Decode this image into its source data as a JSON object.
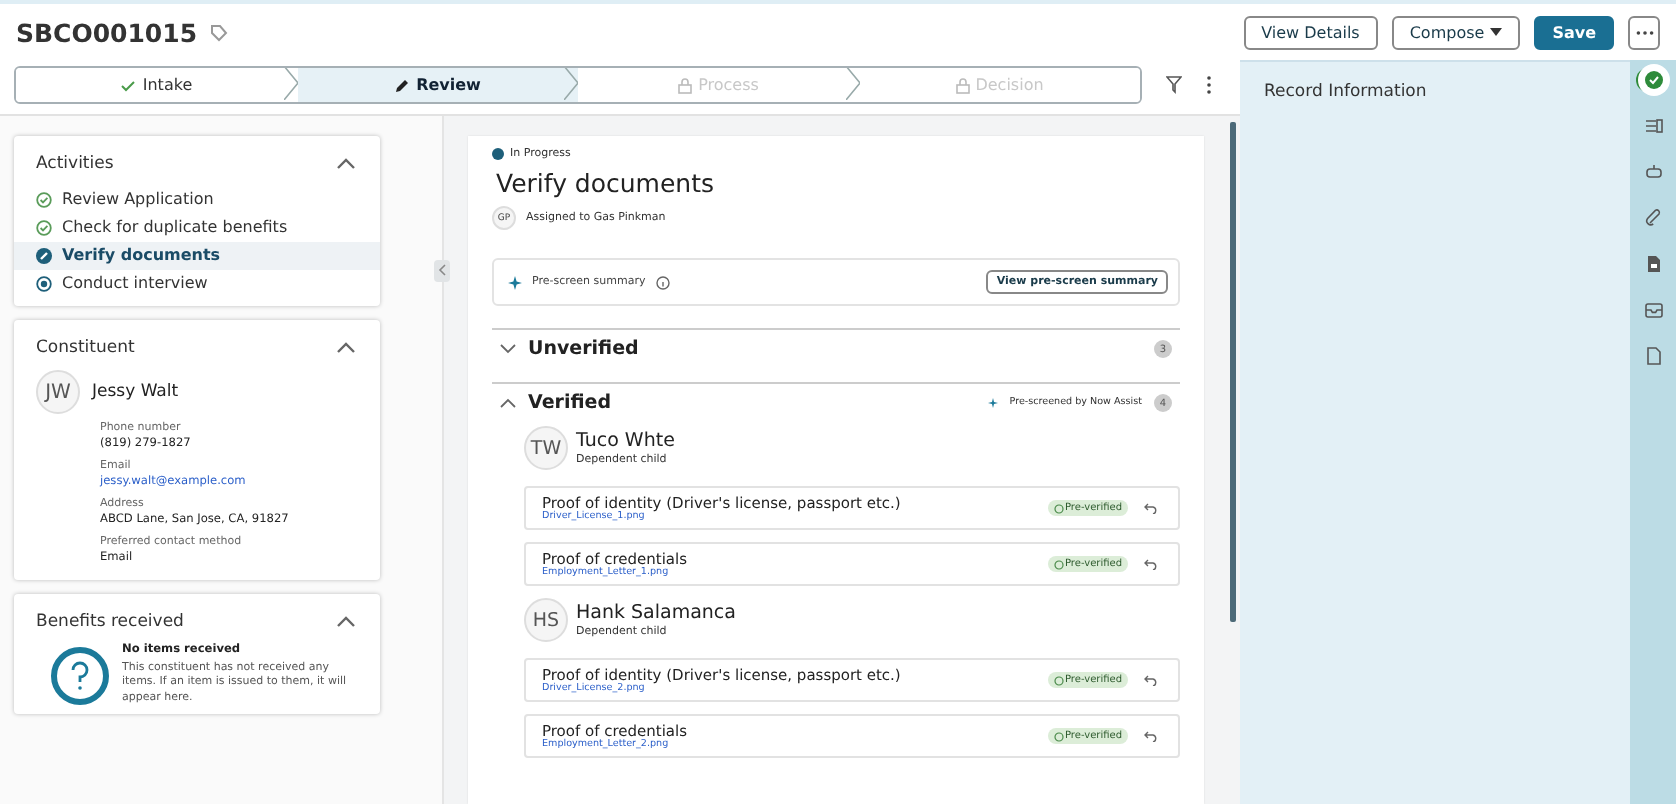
{
  "header": {
    "title": "SBCO001015",
    "buttons": [
      {
        "label": "View Details",
        "kind": "outline"
      },
      {
        "label": "Compose",
        "kind": "dropdown"
      },
      {
        "label": "Save",
        "kind": "primary"
      },
      {
        "kind": "more"
      }
    ]
  },
  "stages": [
    {
      "label": "Intake",
      "kind": "done",
      "selected": false
    },
    {
      "label": "Review",
      "kind": "current",
      "selected": true
    },
    {
      "label": "Process",
      "kind": "locked",
      "selected": false
    },
    {
      "label": "Decision",
      "kind": "locked",
      "selected": false
    }
  ],
  "activities": {
    "title": "Activities",
    "expanded": true,
    "items": [
      {
        "label": "Review Application",
        "kind": "done",
        "selected": false
      },
      {
        "label": "Check for duplicate benefits",
        "kind": "done",
        "selected": false
      },
      {
        "label": "Verify documents",
        "kind": "current",
        "selected": true
      },
      {
        "label": "Conduct interview",
        "kind": "pending",
        "selected": false
      }
    ]
  },
  "constituent": {
    "title": "Constituent",
    "initials": "JW",
    "name": "Jessy Walt",
    "fields": [
      {
        "label": "Phone number",
        "value": "(819) 279-1827",
        "kind": "text"
      },
      {
        "label": "Email",
        "value": "jessy.walt@example.com",
        "kind": "link"
      },
      {
        "label": "Address",
        "value": "ABCD Lane, San Jose, CA, 91827",
        "kind": "text"
      },
      {
        "label": "Preferred contact method",
        "value": "Email",
        "kind": "text"
      }
    ]
  },
  "benefits": {
    "title": "Benefits received",
    "empty_title": "No items received",
    "empty_message": "This constituent has not received any items. If an item is issued to them, it will appear here."
  },
  "task": {
    "status": "In Progress",
    "title": "Verify documents",
    "assignee_initials": "GP",
    "assignee": "Assigned to Gas Pinkman",
    "summary": {
      "label": "Pre-screen summary",
      "button": "View pre-screen summary"
    },
    "sections": [
      {
        "title": "Unverified",
        "count": "3",
        "expanded": false
      },
      {
        "title": "Verified",
        "count": "4",
        "expanded": true,
        "note": "Pre-screened by Now Assist",
        "people": [
          {
            "initials": "TW",
            "name": "Tuco Whte",
            "role": "Dependent child",
            "documents": [
              {
                "title": "Proof of identity (Driver's license, passport etc.)",
                "file": "Driver_License_1.png",
                "badge": "Pre-verified"
              },
              {
                "title": "Proof of credentials",
                "file": "Employment_Letter_1.png",
                "badge": "Pre-verified"
              }
            ]
          },
          {
            "initials": "HS",
            "name": "Hank Salamanca",
            "role": "Dependent child",
            "documents": [
              {
                "title": "Proof of identity (Driver's license, passport etc.)",
                "file": "Driver_License_2.png",
                "badge": "Pre-verified"
              },
              {
                "title": "Proof of credentials",
                "file": "Employment_Letter_2.png",
                "badge": "Pre-verified"
              }
            ]
          }
        ]
      }
    ]
  },
  "record_panel": {
    "title": "Record Information"
  },
  "rail": [
    {
      "kind": "check",
      "selected": true
    },
    {
      "kind": "list",
      "selected": false
    },
    {
      "kind": "bot",
      "selected": false
    },
    {
      "kind": "clip",
      "selected": false
    },
    {
      "kind": "doc",
      "selected": false
    },
    {
      "kind": "inbox",
      "selected": false
    },
    {
      "kind": "file",
      "selected": false
    }
  ]
}
